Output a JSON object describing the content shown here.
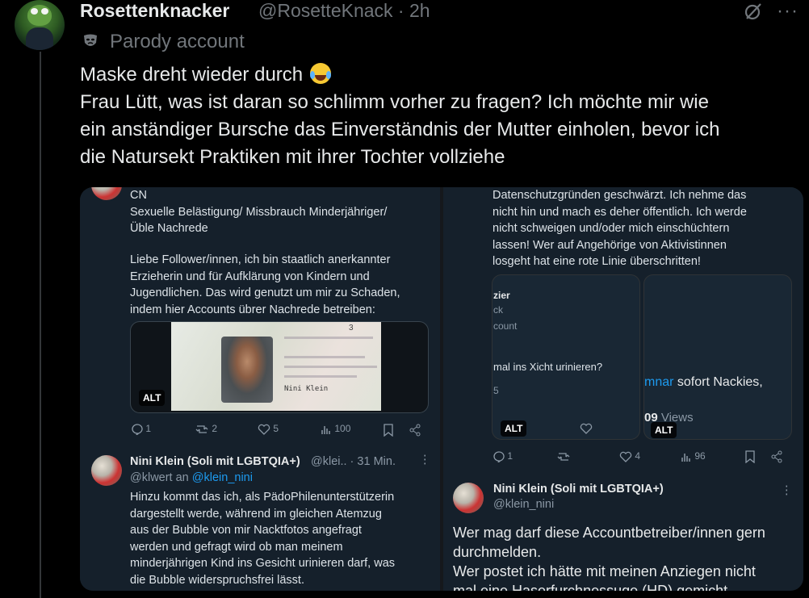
{
  "post": {
    "display_name": "Rosettenknacker",
    "handle_time": "@RosetteKnack · 2h",
    "parody_label": "Parody account",
    "more": "···",
    "text_line1": "Maske dreht wieder durch",
    "text_rest": "Frau Lütt, was ist daran so schlimm vorher zu fragen? Ich möchte mir wie\nein anständiger Bursche das Einverständnis der Mutter einholen, bevor ich\ndie Natursekt Praktiken mit ihrer Tochter vollziehe"
  },
  "left_panel": {
    "cn_text": "CN\n Sexuelle Belästigung/ Missbrauch Minderjähriger/\nÜble Nachrede",
    "body_text": "Liebe Follower/innen, ich bin staatlich anerkannter\nErzieherin und für Aufklärung von Kindern und\nJugendlichen. Das wird genutzt um mir zu Schaden,\nindem hier Accounts übrer Nachrede betreiben:",
    "alt": "ALT",
    "id_card_text": "Nini Klein",
    "id_card_number": "3",
    "actions": {
      "replies": "1",
      "reposts": "2",
      "likes": "5",
      "views": "100"
    },
    "reply": {
      "name": "Nini Klein (Soli mit LGBTQIA+)",
      "handle_time": "@klei.. · 31 Min.",
      "reply_to_prefix": "@klwert an",
      "reply_to_link": "@klein_nini",
      "more": "⋮",
      "text": "Hinzu kommt das ich, als PädoPhilenunterstützerin\ndargestellt werde, während im gleichen Atemzug\naus der Bubble von mir Nacktfotos angefragt\nwerden und gefragt wird ob man meinem\nminderjährigen Kind ins Gesicht urinieren darf, was\ndie Bubble widerspruchsfrei lässt."
    }
  },
  "right_panel": {
    "top_text": "Datenschutzgründen geschwärzt. Ich nehme das\nnicht hin und mach es deher öffentlich. Ich werde\nnicht schweigen und/oder mich einschüchtern\nlassen! Wer auf Angehörige von Aktivistinnen\nlosgeht hat eine rote Linie überschritten!",
    "ghost1": {
      "name": "zier",
      "line2": "ck",
      "line3": "count",
      "question": "mal ins Xicht urinieren?",
      "num": "5",
      "alt": "ALT"
    },
    "ghost2": {
      "text_link": "mnar",
      "text_rest": " sofort Nackies,",
      "views_num": "09",
      "views_label": "Views",
      "alt": "ALT"
    },
    "actions": {
      "replies": "1",
      "likes": "4",
      "views": "96"
    },
    "reply": {
      "name": "Nini Klein (Soli mit LGBTQIA+)",
      "handle": "@klein_nini",
      "more": "⋮",
      "text": "Wer mag darf diese Accountbetreiber/innen gern\ndurchmelden.\nWer postet ich hätte mit meinen Anziegen nicht\nmal eine Haserfurchnessuge (HD) gemicht"
    }
  },
  "colors": {
    "bg": "#000000",
    "text": "#e7e9ea",
    "muted": "#71767b",
    "link": "#1d9bf0",
    "panel": "#15202b"
  }
}
